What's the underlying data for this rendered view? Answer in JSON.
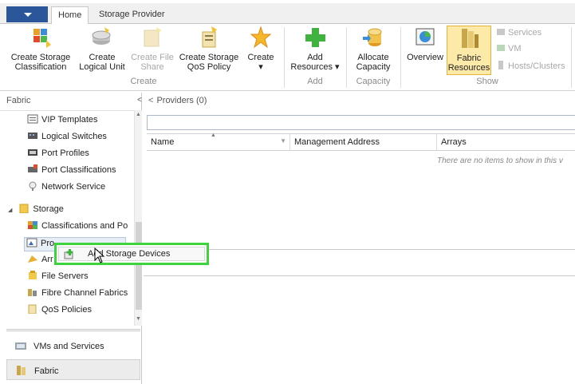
{
  "tabs": [
    {
      "label": "Home",
      "active": true
    },
    {
      "label": "Storage Provider",
      "active": false
    }
  ],
  "ribbon": {
    "create_group": {
      "label": "Create",
      "buttons": [
        {
          "line1": "Create Storage",
          "line2": "Classification",
          "enabled": true
        },
        {
          "line1": "Create",
          "line2": "Logical Unit",
          "enabled": true
        },
        {
          "line1": "Create File",
          "line2": "Share",
          "enabled": false
        },
        {
          "line1": "Create Storage",
          "line2": "QoS Policy",
          "enabled": true
        },
        {
          "line1": "Create",
          "line2": "▾",
          "enabled": true
        }
      ]
    },
    "add_group": {
      "label": "Add",
      "buttons": [
        {
          "line1": "Add",
          "line2": "Resources ▾",
          "enabled": true
        }
      ]
    },
    "capacity_group": {
      "label": "Capacity",
      "buttons": [
        {
          "line1": "Allocate",
          "line2": "Capacity",
          "enabled": true
        }
      ]
    },
    "show_group": {
      "label": "Show",
      "buttons": [
        {
          "line1": "Overview",
          "line2": "",
          "enabled": true
        },
        {
          "line1": "Fabric",
          "line2": "Resources",
          "enabled": true,
          "selected": true
        }
      ],
      "small_items": [
        "Services",
        "VM",
        "Hosts/Clusters"
      ]
    }
  },
  "nav": {
    "title": "Fabric",
    "collapse_glyph": "<",
    "tree": [
      {
        "label": "VIP Templates",
        "icon": "vip-template-icon"
      },
      {
        "label": "Logical Switches",
        "icon": "logical-switch-icon"
      },
      {
        "label": "Port Profiles",
        "icon": "port-profile-icon"
      },
      {
        "label": "Port Classifications",
        "icon": "port-classification-icon"
      },
      {
        "label": "Network Service",
        "icon": "network-service-icon"
      },
      {
        "label": "Storage",
        "icon": "storage-folder-icon",
        "expander": "◢"
      },
      {
        "label": "Classifications and Po",
        "icon": "classification-icon"
      },
      {
        "label": "Pro",
        "icon": "provider-icon"
      },
      {
        "label": "Arr",
        "icon": "array-icon"
      },
      {
        "label": "File Servers",
        "icon": "file-server-icon"
      },
      {
        "label": "Fibre Channel Fabrics",
        "icon": "fibre-channel-icon"
      },
      {
        "label": "QoS Policies",
        "icon": "qos-policy-icon"
      }
    ],
    "workspaces": [
      {
        "label": "VMs and Services",
        "active": false
      },
      {
        "label": "Fabric",
        "active": true
      }
    ]
  },
  "main": {
    "header": "Providers (0)",
    "collapse_glyph": "<",
    "columns": [
      "Name",
      "Management Address",
      "Arrays"
    ],
    "empty_message": "There are no items to show in this v"
  },
  "context_menu": {
    "item": "Add Storage Devices"
  },
  "colors": {
    "accent": "#2b579a",
    "highlight_border": "#3ed43e",
    "selected_fill": "#fde9a8"
  }
}
